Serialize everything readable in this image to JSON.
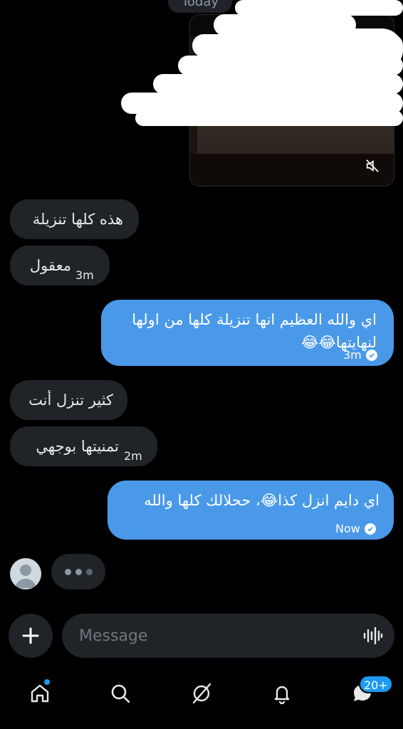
{
  "header": {
    "date_divider": "Today"
  },
  "messages": [
    {
      "side": "in",
      "text": "هذه كلها تنزيلة",
      "time": ""
    },
    {
      "side": "in",
      "text": "معقول",
      "time": "3m"
    },
    {
      "side": "out",
      "line1": "اي والله العظيم انها تنزيلة كلها من اولها",
      "line2": "لنهايتها😂😂",
      "time": "3m"
    },
    {
      "side": "in",
      "text": "كثير تنزل أنت",
      "time": ""
    },
    {
      "side": "in",
      "text": "تمنيتها بوجهي",
      "time": "2m"
    },
    {
      "side": "out",
      "text": "اي دايم انزل كذا😂، ححلالك كلها والله",
      "time": "Now"
    }
  ],
  "composer": {
    "placeholder": "Message"
  },
  "nav": {
    "items": [
      "home-icon",
      "search-icon",
      "grok-icon",
      "notifications-icon",
      "messages-icon"
    ],
    "messages_badge": "20+"
  },
  "colors": {
    "outgoing": "#4a99e9",
    "incoming": "#202327",
    "accent": "#1d9bf0"
  }
}
